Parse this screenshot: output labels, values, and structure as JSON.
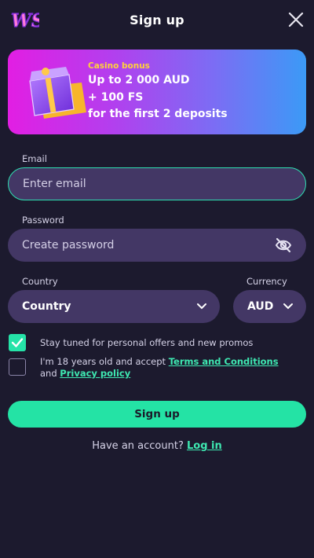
{
  "header": {
    "title": "Sign up",
    "logo_text": "WS",
    "close_icon": "close-icon"
  },
  "banner": {
    "tag": "Casino bonus",
    "line1": "Up to 2 000 AUD",
    "line2": "+ 100 FS",
    "line3": "for the first 2 deposits"
  },
  "email": {
    "label": "Email",
    "placeholder": "Enter email"
  },
  "password": {
    "label": "Password",
    "placeholder": "Create password",
    "toggle_icon": "eye-off-icon"
  },
  "country": {
    "label": "Country",
    "value": "Country"
  },
  "currency": {
    "label": "Currency",
    "value": "AUD"
  },
  "options": {
    "promos_text": "Stay tuned for personal offers and new promos",
    "promos_checked": true,
    "age_text_prefix": "I'm 18 years old and accept ",
    "terms_link": "Terms and Conditions",
    "age_text_and": "and ",
    "privacy_link": "Privacy policy",
    "age_checked": false
  },
  "actions": {
    "signup_label": "Sign up",
    "have_account": "Have an account?",
    "login_link": "Log in"
  },
  "colors": {
    "background": "#1c1a2e",
    "field": "#433765",
    "accent": "#24e3a5",
    "bonus_tag": "#ffd23a"
  }
}
